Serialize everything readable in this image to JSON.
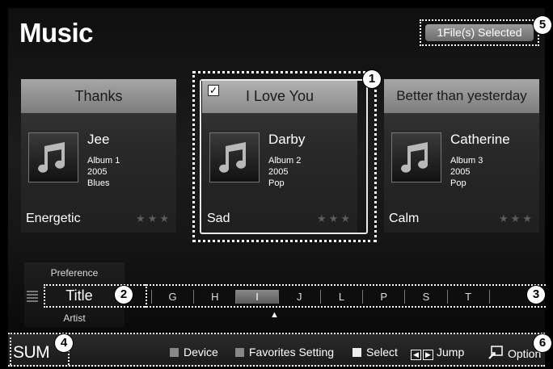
{
  "header": {
    "title": "Music",
    "selection_status": "1File(s) Selected"
  },
  "cards": [
    {
      "title": "Thanks",
      "artist": "Jee",
      "album": "Album 1",
      "year": "2005",
      "genre": "Blues",
      "mood": "Energetic",
      "rating": "★★★",
      "checked": false
    },
    {
      "title": "I Love You",
      "artist": "Darby",
      "album": "Album 2",
      "year": "2005",
      "genre": "Pop",
      "mood": "Sad",
      "rating": "★★★",
      "checked": true
    },
    {
      "title": "Better than yesterday",
      "artist": "Catherine",
      "album": "Album 3",
      "year": "2005",
      "genre": "Pop",
      "mood": "Calm",
      "rating": "★★★",
      "checked": false
    }
  ],
  "sort": {
    "prev": "Preference",
    "current": "Title",
    "next": "Artist"
  },
  "alphabet": {
    "letters": [
      "G",
      "H",
      "I",
      "J",
      "L",
      "P",
      "S",
      "T",
      ""
    ],
    "active": "I"
  },
  "footer": {
    "device": "SUM",
    "device_label": "Device",
    "favorites_label": "Favorites Setting",
    "select_label": "Select",
    "jump_label": "Jump",
    "option_label": "Option"
  },
  "callouts": [
    "1",
    "2",
    "3",
    "4",
    "5",
    "6"
  ]
}
